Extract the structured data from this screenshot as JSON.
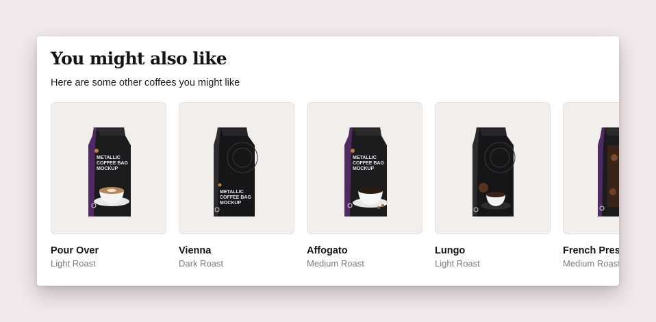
{
  "section": {
    "title": "You might also like",
    "subtitle": "Here are some other coffees you might like"
  },
  "products": [
    {
      "name": "Pour Over",
      "roast": "Light Roast",
      "image_icon": "coffee-bag-icon",
      "bag_text": [
        "METALLIC",
        "COFFEE BAG",
        "MOCKUP"
      ],
      "cup": "latte-cup"
    },
    {
      "name": "Vienna",
      "roast": "Dark Roast",
      "image_icon": "coffee-bag-icon",
      "bag_text": [
        "METALLIC",
        "COFFEE BAG",
        "MOCKUP"
      ],
      "cup": "none"
    },
    {
      "name": "Affogato",
      "roast": "Medium Roast",
      "image_icon": "coffee-bag-icon",
      "bag_text": [
        "METALLIC",
        "COFFEE BAG",
        "MOCKUP"
      ],
      "cup": "black-cup"
    },
    {
      "name": "Lungo",
      "roast": "Light Roast",
      "image_icon": "coffee-bag-icon",
      "bag_text": [],
      "cup": "espresso-cup"
    },
    {
      "name": "French Press",
      "roast": "Medium Roast",
      "image_icon": "coffee-bag-icon",
      "bag_text": [],
      "cup": "beans"
    }
  ],
  "colors": {
    "page_bg": "#f2e9ea",
    "card_bg": "#ffffff",
    "thumb_bg": "#f1eeec",
    "bag": "#1c1b1d",
    "bag_accent": "#5b2a6b",
    "roast_text": "#7b7b7b"
  }
}
